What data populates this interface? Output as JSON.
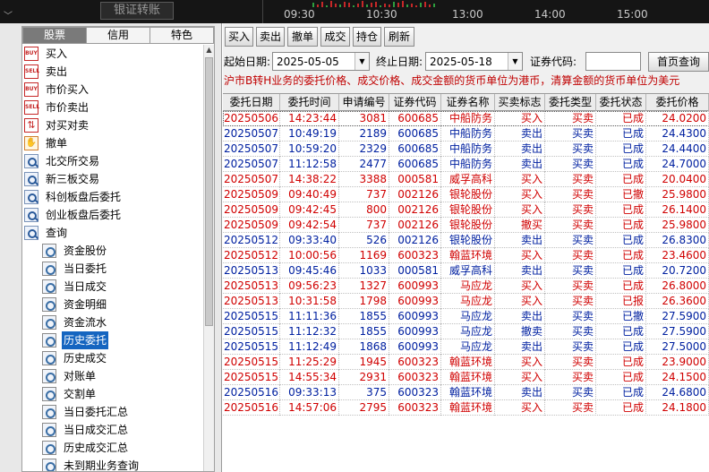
{
  "top": {
    "transfer_label": "银证转账",
    "times": [
      "09:30",
      "10:30",
      "13:00",
      "14:00",
      "15:00"
    ]
  },
  "left": {
    "tabs": [
      "股票",
      "信用",
      "特色"
    ],
    "items": [
      {
        "label": "买入",
        "icon": "buy-icon"
      },
      {
        "label": "卖出",
        "icon": "sell-icon"
      },
      {
        "label": "市价买入",
        "icon": "buy-icon"
      },
      {
        "label": "市价卖出",
        "icon": "sell-icon"
      },
      {
        "label": "对买对卖",
        "icon": "swap-icon"
      },
      {
        "label": "撤单",
        "icon": "cancel-icon"
      },
      {
        "label": "北交所交易",
        "icon": "search-icon"
      },
      {
        "label": "新三板交易",
        "icon": "search-icon"
      },
      {
        "label": "科创板盘后委托",
        "icon": "search-icon"
      },
      {
        "label": "创业板盘后委托",
        "icon": "search-icon"
      },
      {
        "label": "查询",
        "icon": "search-icon"
      }
    ],
    "query_items": [
      "资金股份",
      "当日委托",
      "当日成交",
      "资金明细",
      "资金流水",
      "历史委托",
      "历史成交",
      "对账单",
      "交割单",
      "当日委托汇总",
      "当日成交汇总",
      "历史成交汇总",
      "未到期业务查询"
    ]
  },
  "toolbar": {
    "buttons": [
      "买入",
      "卖出",
      "撤单",
      "成交",
      "持仓",
      "刷新"
    ]
  },
  "filter": {
    "start_label": "起始日期:",
    "start_date": "2025-05-05",
    "end_label": "终止日期:",
    "end_date": "2025-05-18",
    "code_label": "证券代码:",
    "code_value": "",
    "first_page": "首页查询"
  },
  "notice": "沪市B转H业务的委托价格、成交价格、成交金额的货币单位为港币，清算金额的货币单位为美元",
  "table": {
    "columns": [
      "委托日期",
      "委托时间",
      "申请编号",
      "证券代码",
      "证券名称",
      "买卖标志",
      "委托类型",
      "委托状态",
      "委托价格"
    ],
    "rows": [
      [
        "20250506",
        "14:23:44",
        "3081",
        "600685",
        "中船防务",
        "买入",
        "买卖",
        "已成",
        "24.0200"
      ],
      [
        "20250507",
        "10:49:19",
        "2189",
        "600685",
        "中船防务",
        "卖出",
        "买卖",
        "已成",
        "24.4300"
      ],
      [
        "20250507",
        "10:59:20",
        "2329",
        "600685",
        "中船防务",
        "卖出",
        "买卖",
        "已成",
        "24.4400"
      ],
      [
        "20250507",
        "11:12:58",
        "2477",
        "600685",
        "中船防务",
        "卖出",
        "买卖",
        "已成",
        "24.7000"
      ],
      [
        "20250507",
        "14:38:22",
        "3388",
        "000581",
        "威孚高科",
        "买入",
        "买卖",
        "已成",
        "20.0400"
      ],
      [
        "20250509",
        "09:40:49",
        "737",
        "002126",
        "银轮股份",
        "买入",
        "买卖",
        "已撤",
        "25.9800"
      ],
      [
        "20250509",
        "09:42:45",
        "800",
        "002126",
        "银轮股份",
        "买入",
        "买卖",
        "已成",
        "26.1400"
      ],
      [
        "20250509",
        "09:42:54",
        "737",
        "002126",
        "银轮股份",
        "撤买",
        "买卖",
        "已成",
        "25.9800"
      ],
      [
        "20250512",
        "09:33:40",
        "526",
        "002126",
        "银轮股份",
        "卖出",
        "买卖",
        "已成",
        "26.8300"
      ],
      [
        "20250512",
        "10:00:56",
        "1169",
        "600323",
        "翰蓝环境",
        "买入",
        "买卖",
        "已成",
        "23.4600"
      ],
      [
        "20250513",
        "09:45:46",
        "1033",
        "000581",
        "威孚高科",
        "卖出",
        "买卖",
        "已成",
        "20.7200"
      ],
      [
        "20250513",
        "09:56:23",
        "1327",
        "600993",
        "马应龙",
        "买入",
        "买卖",
        "已成",
        "26.8000"
      ],
      [
        "20250513",
        "10:31:58",
        "1798",
        "600993",
        "马应龙",
        "买入",
        "买卖",
        "已报",
        "26.3600"
      ],
      [
        "20250515",
        "11:11:36",
        "1855",
        "600993",
        "马应龙",
        "卖出",
        "买卖",
        "已撤",
        "27.5900"
      ],
      [
        "20250515",
        "11:12:32",
        "1855",
        "600993",
        "马应龙",
        "撤卖",
        "买卖",
        "已成",
        "27.5900"
      ],
      [
        "20250515",
        "11:12:49",
        "1868",
        "600993",
        "马应龙",
        "卖出",
        "买卖",
        "已成",
        "27.5000"
      ],
      [
        "20250515",
        "11:25:29",
        "1945",
        "600323",
        "翰蓝环境",
        "买入",
        "买卖",
        "已成",
        "23.9000"
      ],
      [
        "20250515",
        "14:55:34",
        "2931",
        "600323",
        "翰蓝环境",
        "买入",
        "买卖",
        "已成",
        "24.1500"
      ],
      [
        "20250516",
        "09:33:13",
        "375",
        "600323",
        "翰蓝环境",
        "卖出",
        "买卖",
        "已成",
        "24.6800"
      ],
      [
        "20250516",
        "14:57:06",
        "2795",
        "600323",
        "翰蓝环境",
        "买入",
        "买卖",
        "已成",
        "24.1800"
      ]
    ]
  },
  "colors": {
    "buy_row": "#d00000",
    "sell_row": "#0020a0",
    "selected_item": "#1565c0",
    "notice": "#c00000"
  }
}
